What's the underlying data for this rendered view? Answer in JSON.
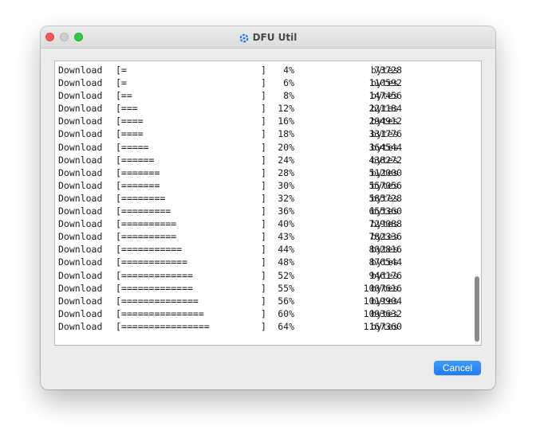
{
  "window": {
    "title": "DFU Util",
    "app_icon": "dfu-util-app-icon"
  },
  "log": {
    "lines": [
      {
        "action": "Download",
        "bar": "[=",
        "bar_end": "]",
        "percent": "4%",
        "bytes": "73728",
        "unit": "bytes"
      },
      {
        "action": "Download",
        "bar": "[=",
        "bar_end": "]",
        "percent": "6%",
        "bytes": "110592",
        "unit": "bytes"
      },
      {
        "action": "Download",
        "bar": "[==",
        "bar_end": "]",
        "percent": "8%",
        "bytes": "147456",
        "unit": "bytes"
      },
      {
        "action": "Download",
        "bar": "[===",
        "bar_end": "]",
        "percent": "12%",
        "bytes": "221184",
        "unit": "bytes"
      },
      {
        "action": "Download",
        "bar": "[====",
        "bar_end": "]",
        "percent": "16%",
        "bytes": "294912",
        "unit": "bytes"
      },
      {
        "action": "Download",
        "bar": "[====",
        "bar_end": "]",
        "percent": "18%",
        "bytes": "331776",
        "unit": "bytes"
      },
      {
        "action": "Download",
        "bar": "[=====",
        "bar_end": "]",
        "percent": "20%",
        "bytes": "364544",
        "unit": "bytes"
      },
      {
        "action": "Download",
        "bar": "[======",
        "bar_end": "]",
        "percent": "24%",
        "bytes": "438272",
        "unit": "bytes"
      },
      {
        "action": "Download",
        "bar": "[=======",
        "bar_end": "]",
        "percent": "28%",
        "bytes": "512000",
        "unit": "bytes"
      },
      {
        "action": "Download",
        "bar": "[=======",
        "bar_end": "]",
        "percent": "30%",
        "bytes": "557056",
        "unit": "bytes"
      },
      {
        "action": "Download",
        "bar": "[========",
        "bar_end": "]",
        "percent": "32%",
        "bytes": "585728",
        "unit": "bytes"
      },
      {
        "action": "Download",
        "bar": "[=========",
        "bar_end": "]",
        "percent": "36%",
        "bytes": "655360",
        "unit": "bytes"
      },
      {
        "action": "Download",
        "bar": "[==========",
        "bar_end": "]",
        "percent": "40%",
        "bytes": "729088",
        "unit": "bytes"
      },
      {
        "action": "Download",
        "bar": "[==========",
        "bar_end": "]",
        "percent": "43%",
        "bytes": "782336",
        "unit": "bytes"
      },
      {
        "action": "Download",
        "bar": "[===========",
        "bar_end": "]",
        "percent": "44%",
        "bytes": "802816",
        "unit": "bytes"
      },
      {
        "action": "Download",
        "bar": "[============",
        "bar_end": "]",
        "percent": "48%",
        "bytes": "876544",
        "unit": "bytes"
      },
      {
        "action": "Download",
        "bar": "[=============",
        "bar_end": "]",
        "percent": "52%",
        "bytes": "946176",
        "unit": "bytes"
      },
      {
        "action": "Download",
        "bar": "[=============",
        "bar_end": "]",
        "percent": "55%",
        "bytes": "1007616",
        "unit": "bytes"
      },
      {
        "action": "Download",
        "bar": "[==============",
        "bar_end": "]",
        "percent": "56%",
        "bytes": "1019904",
        "unit": "bytes"
      },
      {
        "action": "Download",
        "bar": "[===============",
        "bar_end": "]",
        "percent": "60%",
        "bytes": "1093632",
        "unit": "bytes"
      },
      {
        "action": "Download",
        "bar": "[================",
        "bar_end": "]",
        "percent": "64%",
        "bytes": "1167360",
        "unit": "bytes"
      }
    ]
  },
  "buttons": {
    "cancel_label": "Cancel"
  },
  "colors": {
    "accent": "#1f7cf1",
    "close": "#fc5753",
    "zoom": "#34c84a"
  }
}
